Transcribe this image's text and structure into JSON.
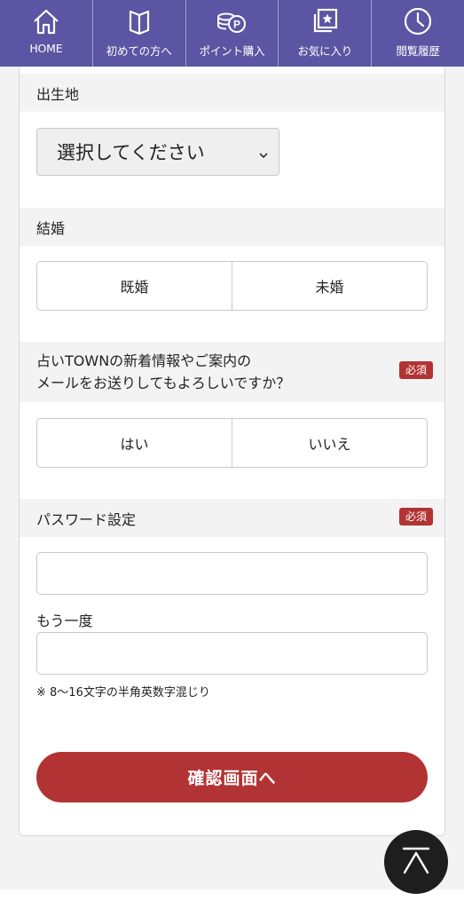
{
  "nav": {
    "items": [
      {
        "label": "HOME",
        "icon": "home-icon"
      },
      {
        "label": "初めての方へ",
        "icon": "book-icon"
      },
      {
        "label": "ポイント購入",
        "icon": "coins-icon"
      },
      {
        "label": "お気に入り",
        "icon": "star-cards-icon"
      },
      {
        "label": "閲覧履歴",
        "icon": "clock-icon"
      }
    ],
    "bg_color": "#5b55a3"
  },
  "form": {
    "birthplace": {
      "heading": "出生地",
      "select_value": "選択してください"
    },
    "marriage": {
      "heading": "結婚",
      "options": [
        "既婚",
        "未婚"
      ]
    },
    "mail": {
      "heading_line1": "占いTOWNの新着情報やご案内の",
      "heading_line2": "メールをお送りしてもよろしいですか？",
      "required": "必須",
      "options": [
        "はい",
        "いいえ"
      ]
    },
    "password": {
      "heading": "パスワード設定",
      "required": "必須",
      "confirm_label": "もう一度",
      "note": "※ 8〜16文字の半角英数字混じり"
    },
    "submit_label": "確認画面へ"
  },
  "colors": {
    "accent": "#b23333",
    "nav": "#5b55a3"
  }
}
